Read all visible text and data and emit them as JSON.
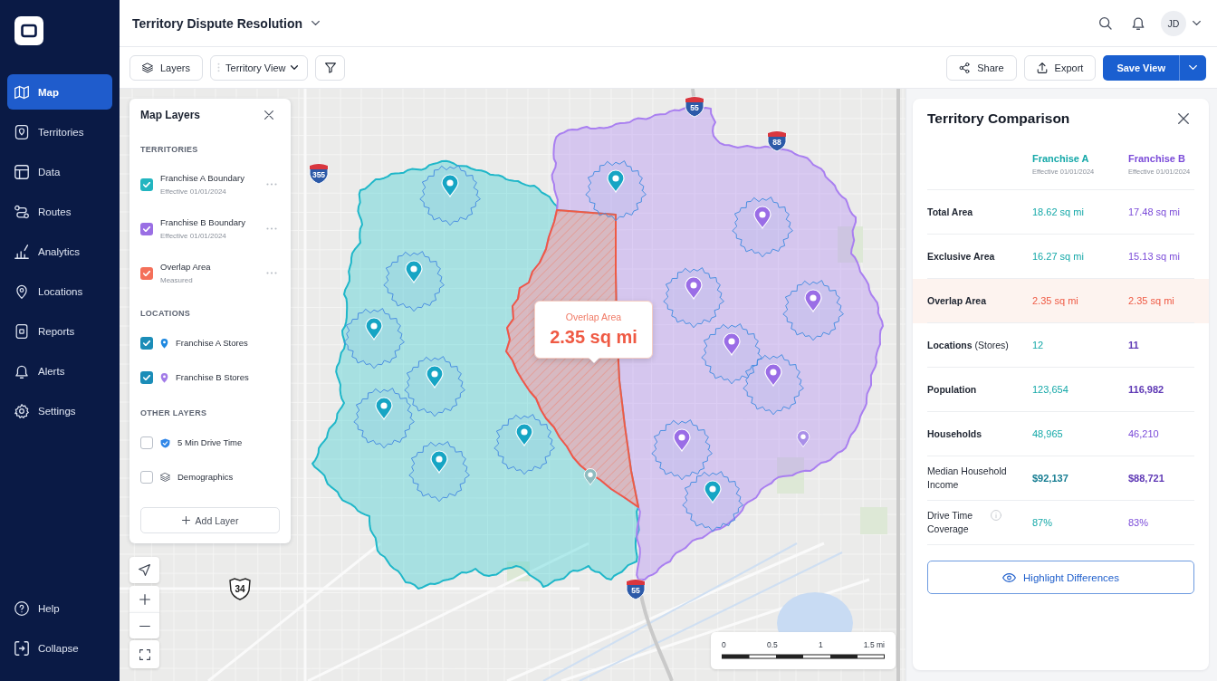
{
  "sidebar": {
    "items": [
      {
        "label": "Map",
        "selected": true
      },
      {
        "label": "Territories",
        "selected": false
      },
      {
        "label": "Data",
        "selected": false
      },
      {
        "label": "Routes",
        "selected": false
      },
      {
        "label": "Analytics",
        "selected": false
      },
      {
        "label": "Locations",
        "selected": false
      },
      {
        "label": "Reports",
        "selected": false
      },
      {
        "label": "Alerts",
        "selected": false
      },
      {
        "label": "Settings",
        "selected": false
      }
    ],
    "footer_items": [
      {
        "label": "Help"
      },
      {
        "label": "Collapse"
      }
    ]
  },
  "header": {
    "title": "Territory Dispute Resolution",
    "avatar": "JD"
  },
  "toolbar": {
    "left": [
      {
        "kind": "button",
        "label": "Layers"
      },
      {
        "kind": "dropdown",
        "label": "Territory View"
      },
      {
        "kind": "icon_button"
      }
    ],
    "right": [
      {
        "kind": "button",
        "label": "Share"
      },
      {
        "kind": "button",
        "label": "Export"
      },
      {
        "kind": "primary",
        "label": "Save View"
      }
    ]
  },
  "layers_panel": {
    "title": "Map Layers",
    "sections": [
      {
        "heading": "TERRITORIES",
        "items": [
          {
            "kind": "territory",
            "label": "Franchise A Boundary",
            "sublabel": "Effective 01/01/2024",
            "checked": true,
            "color": "#22b5c0"
          },
          {
            "kind": "territory",
            "label": "Franchise B Boundary",
            "sublabel": "Effective 01/01/2024",
            "checked": true,
            "color": "#9a6fe4"
          },
          {
            "kind": "territory",
            "label": "Overlap Area",
            "sublabel": "Measured",
            "checked": true,
            "color": "#f4705a"
          }
        ]
      },
      {
        "heading": "LOCATIONS",
        "items": [
          {
            "kind": "location",
            "label": "Franchise A Stores",
            "checked": true,
            "color": "#1e88e0"
          },
          {
            "kind": "location",
            "label": "Franchise B Stores",
            "checked": true,
            "color": "#a27be8"
          }
        ]
      },
      {
        "heading": "OTHER LAYERS",
        "items": [
          {
            "kind": "drive_time",
            "label": "5 Min Drive Time",
            "checked": false
          },
          {
            "kind": "demographics",
            "label": "Demographics",
            "checked": false
          }
        ]
      }
    ],
    "add_label": "Add Layer"
  },
  "map": {
    "callout": {
      "title": "Overlap Area",
      "value": "2.35 sq mi"
    },
    "pins": [
      {
        "color": "#16a5c4"
      },
      {
        "color": "#16a5c4"
      },
      {
        "color": "#16a5c4"
      },
      {
        "color": "#16a5c4"
      },
      {
        "color": "#16a5c4"
      },
      {
        "color": "#16a5c4"
      },
      {
        "color": "#16a5c4"
      },
      {
        "color": "#16a5c4"
      },
      {
        "color": "#16a5c4"
      },
      {
        "color": "#8fbcc0"
      },
      {
        "color": "#9a6de6"
      },
      {
        "color": "#9a6de6"
      },
      {
        "color": "#9a6de6"
      },
      {
        "color": "#9a6de6"
      },
      {
        "color": "#9a6de6"
      },
      {
        "color": "#9a6de6"
      },
      {
        "color": "#a98fe8"
      }
    ],
    "shields": [
      {
        "kind": "interstate",
        "label": "355"
      },
      {
        "kind": "interstate",
        "label": "55"
      },
      {
        "kind": "interstate",
        "label": "88"
      },
      {
        "kind": "us_route",
        "label": "34"
      },
      {
        "kind": "interstate",
        "label": "55"
      }
    ],
    "scale_labels": [
      "0",
      "0.5",
      "1",
      "1.5 mi"
    ]
  },
  "comparison": {
    "title": "Territory Comparison",
    "columns": [
      {
        "name": "Franchise A",
        "sublabel": "Effective 01/01/2024",
        "color": "#14a8a8"
      },
      {
        "name": "Franchise B",
        "sublabel": "Effective 01/01/2024",
        "color": "#7a4ad8"
      }
    ],
    "rows": [
      {
        "label": "Total Area",
        "label_strong": true,
        "highlighted": false,
        "info": false,
        "values": [
          {
            "text": "18.62 sq mi",
            "strong": false
          },
          {
            "text": "17.48 sq mi",
            "strong": false
          }
        ]
      },
      {
        "label": "Exclusive Area",
        "label_strong": true,
        "highlighted": false,
        "info": false,
        "values": [
          {
            "text": "16.27 sq mi",
            "strong": false
          },
          {
            "text": "15.13 sq mi",
            "strong": false
          }
        ]
      },
      {
        "label": "Overlap Area",
        "label_strong": true,
        "highlighted": true,
        "info": false,
        "values": [
          {
            "text": "2.35 sq mi",
            "strong": false
          },
          {
            "text": "2.35 sq mi",
            "strong": false
          }
        ]
      },
      {
        "label": "**Locations** (Stores)",
        "label_strong": false,
        "highlighted": false,
        "info": false,
        "values": [
          {
            "text": "12",
            "strong": false
          },
          {
            "text": "11",
            "strong": true
          }
        ]
      },
      {
        "label": "Population",
        "label_strong": true,
        "highlighted": false,
        "info": false,
        "values": [
          {
            "text": "123,654",
            "strong": false
          },
          {
            "text": "116,982",
            "strong": true
          }
        ]
      },
      {
        "label": "Households",
        "label_strong": true,
        "highlighted": false,
        "info": false,
        "values": [
          {
            "text": "48,965",
            "strong": false
          },
          {
            "text": "46,210",
            "strong": false
          }
        ]
      },
      {
        "label": "Median Household Income",
        "label_strong": false,
        "highlighted": false,
        "info": false,
        "values": [
          {
            "text": "$92,137",
            "strong": true
          },
          {
            "text": "$88,721",
            "strong": true
          }
        ]
      },
      {
        "label": "Drive Time Coverage",
        "label_strong": false,
        "highlighted": false,
        "info": true,
        "values": [
          {
            "text": "87%",
            "strong": false
          },
          {
            "text": "83%",
            "strong": false
          }
        ]
      }
    ],
    "action": "Highlight Differences"
  }
}
